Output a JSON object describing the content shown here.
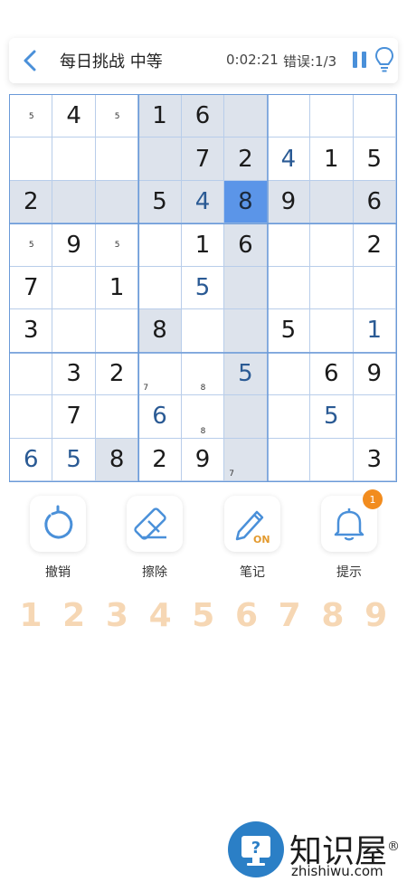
{
  "header": {
    "title": "每日挑战 中等",
    "timer": "0:02:21",
    "mistakes": "错误:1/3"
  },
  "board": {
    "cells": [
      [
        {
          "n": "5"
        },
        {
          "v": "4"
        },
        {
          "n": "5"
        },
        {
          "v": "1"
        },
        {
          "v": "6"
        },
        {},
        {},
        {},
        {}
      ],
      [
        {},
        {},
        {},
        {},
        {
          "v": "7"
        },
        {
          "v": "2"
        },
        {
          "v": "4",
          "u": 1
        },
        {
          "v": "1"
        },
        {
          "v": "5"
        }
      ],
      [
        {
          "v": "2"
        },
        {},
        {},
        {
          "v": "5"
        },
        {
          "v": "4",
          "u": 1
        },
        {
          "v": "8",
          "sel": 1
        },
        {
          "v": "9"
        },
        {},
        {
          "v": "6"
        }
      ],
      [
        {
          "n": "5"
        },
        {
          "v": "9"
        },
        {
          "n": "5"
        },
        {},
        {
          "v": "1"
        },
        {
          "v": "6"
        },
        {},
        {},
        {
          "v": "2"
        }
      ],
      [
        {
          "v": "7"
        },
        {},
        {
          "v": "1"
        },
        {},
        {
          "v": "5",
          "u": 1
        },
        {},
        {},
        {},
        {}
      ],
      [
        {
          "v": "3"
        },
        {},
        {},
        {
          "v": "8",
          "hl": 1
        },
        {},
        {},
        {
          "v": "5"
        },
        {},
        {
          "v": "1",
          "u": 1
        }
      ],
      [
        {},
        {
          "v": "3"
        },
        {
          "v": "2"
        },
        {
          "n": "7"
        },
        {
          "n": "8"
        },
        {
          "v": "5",
          "u": 1
        },
        {},
        {
          "v": "6"
        },
        {
          "v": "9"
        }
      ],
      [
        {},
        {
          "v": "7"
        },
        {},
        {
          "v": "6",
          "u": 1
        },
        {
          "n": "8"
        },
        {},
        {},
        {
          "v": "5",
          "u": 1
        },
        {}
      ],
      [
        {
          "v": "6",
          "u": 1
        },
        {
          "v": "5",
          "u": 1
        },
        {
          "v": "8",
          "hl": 1
        },
        {
          "v": "2"
        },
        {
          "v": "9"
        },
        {
          "n": "7"
        },
        {},
        {},
        {
          "v": "3"
        }
      ]
    ]
  },
  "tools": {
    "undo": "撤销",
    "erase": "擦除",
    "notes": "笔记",
    "notes_state": "ON",
    "hint": "提示",
    "hint_badge": "1"
  },
  "numpad": [
    "1",
    "2",
    "3",
    "4",
    "5",
    "6",
    "7",
    "8",
    "9"
  ],
  "logo": {
    "cn": "知识屋",
    "en": "zhishiwu.com",
    "mark": "®"
  },
  "colors": {
    "accent": "#4a90d9",
    "selected": "#5b95e8",
    "highlight": "#dde3ec",
    "user_digit": "#2a5a94",
    "numpad": "#f6d7b4",
    "badge": "#f28c1e"
  }
}
